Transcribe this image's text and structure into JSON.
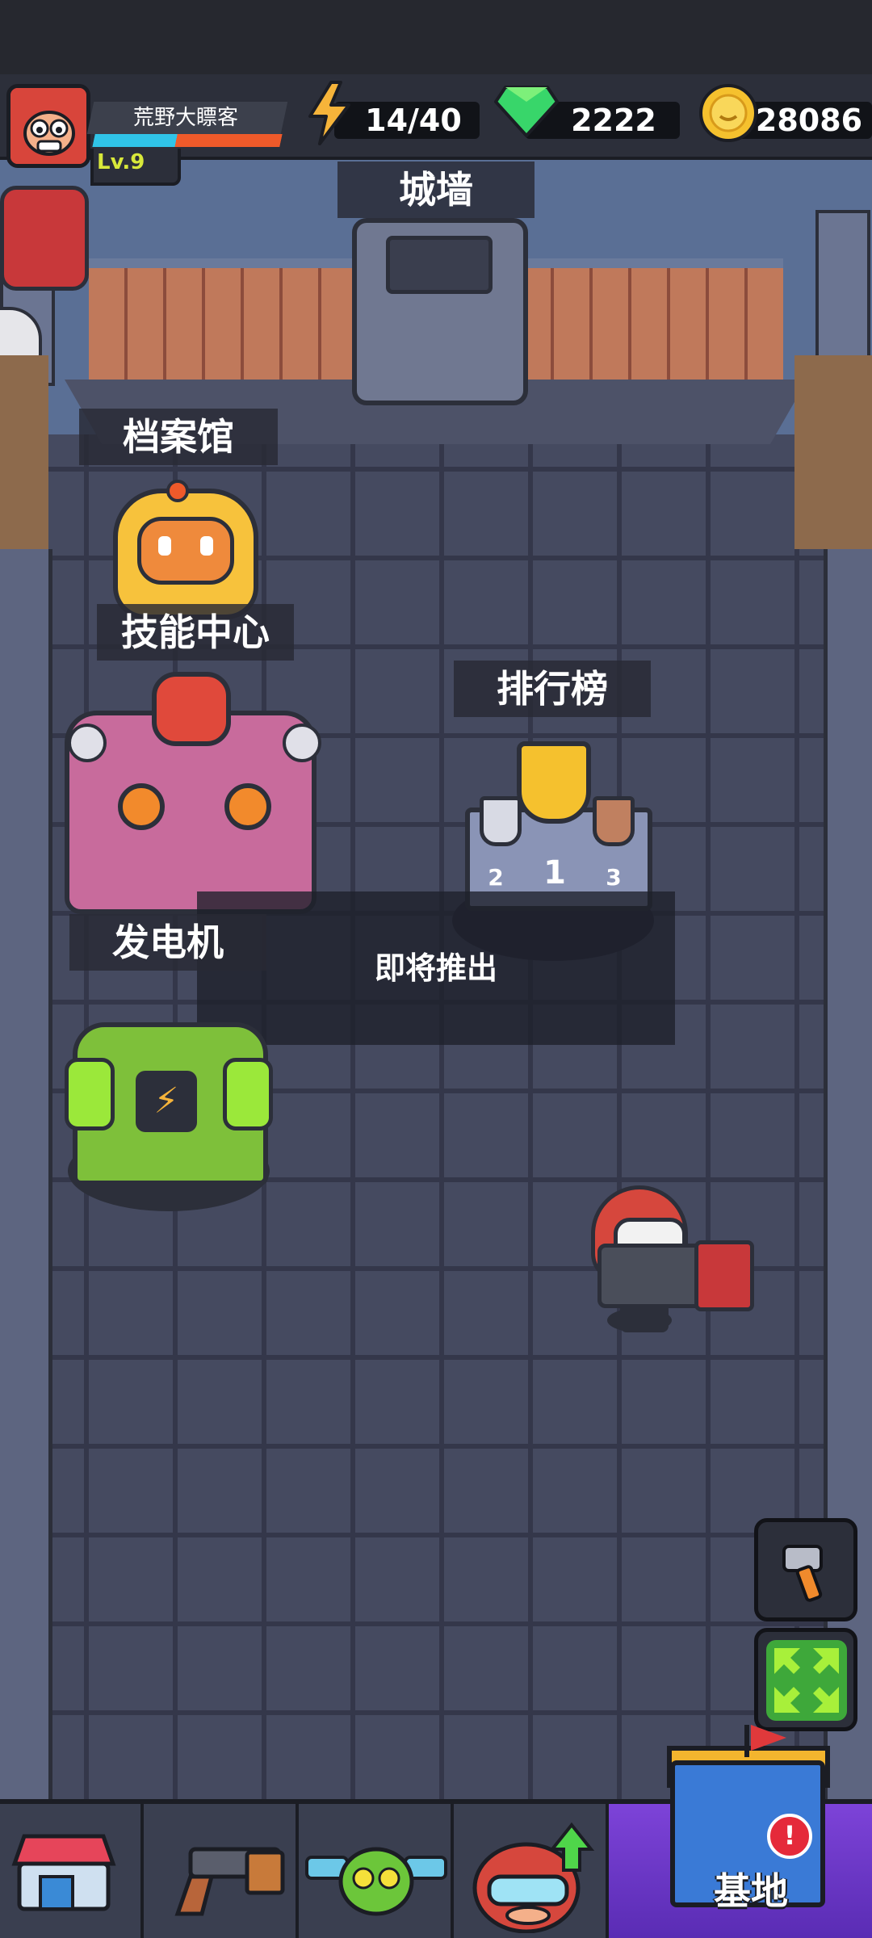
{
  "player": {
    "name": "荒野大瞟客",
    "level": "Lv.9",
    "xp_fraction": 0.44
  },
  "resources": {
    "energy": "14/40",
    "gems": "2222",
    "coins": "28086"
  },
  "buildings": {
    "wall": "城墙",
    "archive": "档案馆",
    "skill_center": "技能中心",
    "leaderboard": "排行榜",
    "generator": "发电机"
  },
  "leaderboard_podium": {
    "first": "1",
    "second": "2",
    "third": "3"
  },
  "overlay": {
    "coming_soon": "即将推出"
  },
  "side_buttons": {
    "build": "hammer-icon",
    "expand": "expand-arrows-icon"
  },
  "nav": {
    "tabs": [
      {
        "icon": "shop-icon"
      },
      {
        "icon": "weapon-gun-icon"
      },
      {
        "icon": "pet-icon"
      },
      {
        "icon": "hero-upgrade-icon"
      },
      {
        "icon": "base-castle-icon",
        "label": "基地"
      }
    ],
    "alert": "!"
  },
  "colors": {
    "hud_bg": "#2c2f3a",
    "energy": "#f6b43a",
    "gem": "#38d66a",
    "coin": "#f5c12e",
    "active_tab": "#7d43d8"
  }
}
